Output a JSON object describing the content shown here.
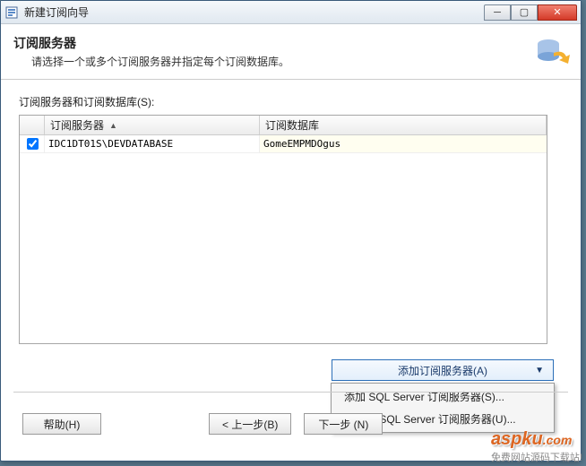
{
  "window": {
    "title": "新建订阅向导"
  },
  "header": {
    "title": "订阅服务器",
    "subtitle": "请选择一个或多个订阅服务器并指定每个订阅数据库。"
  },
  "grid": {
    "label": "订阅服务器和订阅数据库(S):",
    "columns": {
      "server": "订阅服务器",
      "db": "订阅数据库"
    },
    "rows": [
      {
        "checked": true,
        "server": "IDC1DT01S\\DEVDATABASE",
        "db": "GomeEMPMDOgus"
      }
    ]
  },
  "dropdown": {
    "label": "添加订阅服务器(A)",
    "items": [
      "添加 SQL Server 订阅服务器(S)...",
      "添加非 SQL Server 订阅服务器(U)..."
    ]
  },
  "buttons": {
    "help": "帮助(H)",
    "back": "< 上一步(B)",
    "next": "下一步 (N)"
  },
  "watermark": {
    "brand": "aspku",
    "dotcom": ".com",
    "tagline": "免费网站源码下载站!"
  }
}
